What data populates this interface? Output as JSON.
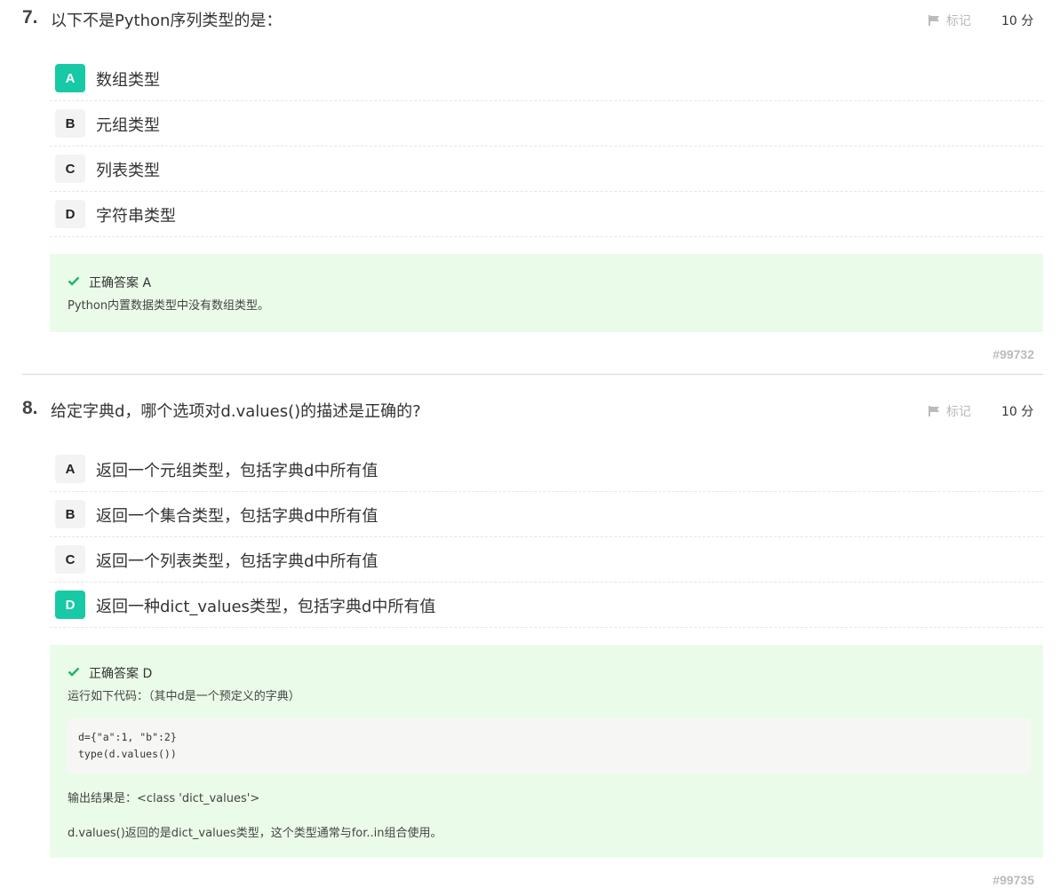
{
  "questions": [
    {
      "number": "7.",
      "title": "以下不是Python序列类型的是：",
      "mark_label": "标记",
      "score": "10 分",
      "options": [
        {
          "letter": "A",
          "text": "数组类型",
          "correct": true
        },
        {
          "letter": "B",
          "text": "元组类型",
          "correct": false
        },
        {
          "letter": "C",
          "text": "列表类型",
          "correct": false
        },
        {
          "letter": "D",
          "text": "字符串类型",
          "correct": false
        }
      ],
      "answer": {
        "label": "正确答案 A",
        "explanation": "Python内置数据类型中没有数组类型。"
      },
      "id": "#99732"
    },
    {
      "number": "8.",
      "title": "给定字典d，哪个选项对d.values()的描述是正确的?",
      "mark_label": "标记",
      "score": "10 分",
      "options": [
        {
          "letter": "A",
          "text": "返回一个元组类型，包括字典d中所有值",
          "correct": false
        },
        {
          "letter": "B",
          "text": "返回一个集合类型，包括字典d中所有值",
          "correct": false
        },
        {
          "letter": "C",
          "text": "返回一个列表类型，包括字典d中所有值",
          "correct": false
        },
        {
          "letter": "D",
          "text": "返回一种dict_values类型，包括字典d中所有值",
          "correct": true
        }
      ],
      "answer": {
        "label": "正确答案 D",
        "intro": "运行如下代码：（其中d是一个预定义的字典）",
        "code": [
          "d={\"a\":1, \"b\":2}",
          "type(d.values())"
        ],
        "output": "输出结果是：<class 'dict_values'>",
        "note": "d.values()返回的是dict_values类型，这个类型通常与for..in组合使用。"
      },
      "id": "#99735"
    }
  ],
  "colors": {
    "correct_badge": "#17c9a4",
    "answer_bg": "#ebfbe9",
    "check": "#1fb56a"
  },
  "icons": {
    "mark": "flag-icon",
    "correct": "check-icon"
  }
}
